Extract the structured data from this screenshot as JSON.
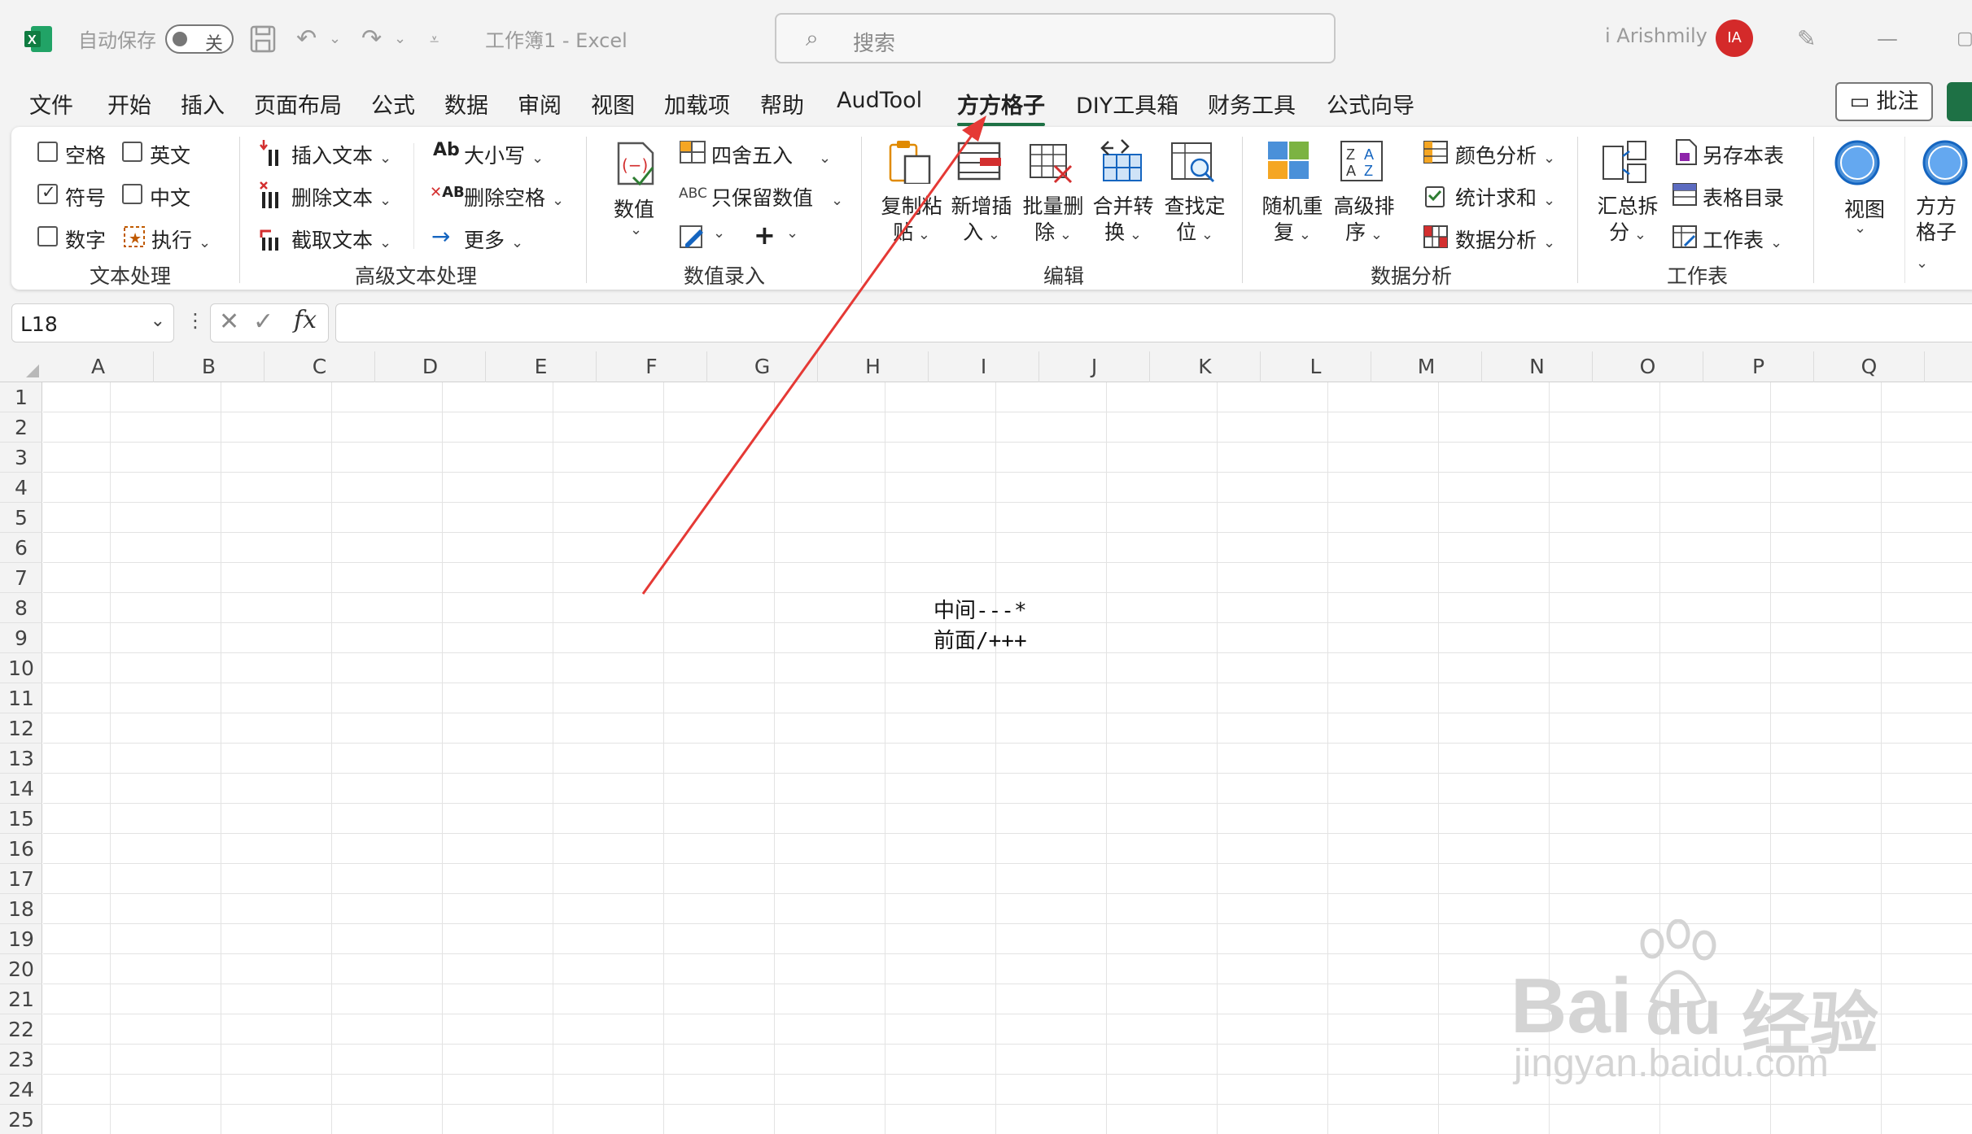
{
  "titlebar": {
    "autosave_label": "自动保存",
    "autosave_state": "关",
    "doc_title": "工作簿1  -  Excel",
    "search_placeholder": "搜索",
    "user_name": "i Arishmily",
    "avatar_initials": "IA"
  },
  "menu": {
    "items": [
      "文件",
      "开始",
      "插入",
      "页面布局",
      "公式",
      "数据",
      "审阅",
      "视图",
      "加载项",
      "帮助",
      "AudTool",
      "方方格子",
      "DIY工具箱",
      "财务工具",
      "公式向导"
    ],
    "active": "方方格子",
    "comment_button": "批注"
  },
  "ribbon": {
    "text_processing": {
      "label": "文本处理",
      "options": [
        "空格",
        "英文",
        "符号",
        "中文",
        "数字"
      ],
      "execute": "执行"
    },
    "advanced_text": {
      "label": "高级文本处理",
      "insert_text": "插入文本",
      "delete_text": "删除文本",
      "extract_text": "截取文本",
      "case": "大小写",
      "delete_spaces": "删除空格",
      "more": "更多"
    },
    "numeric_entry": {
      "label": "数值录入",
      "value_btn": "数值",
      "round": "四舍五入",
      "keep_values": "只保留数值",
      "abc_icon_text": "ABC"
    },
    "edit": {
      "label": "编辑",
      "buttons": [
        "复制粘贴",
        "新增插入",
        "批量删除",
        "合并转换",
        "查找定位"
      ]
    },
    "data_analysis": {
      "label": "数据分析",
      "buttons": [
        "随机重复",
        "高级排序"
      ],
      "color_analysis": "颜色分析",
      "stat_sum": "统计求和",
      "data_analysis_btn": "数据分析"
    },
    "worksheet": {
      "label": "工作表",
      "summary_split": "汇总拆分",
      "save_sheet": "另存本表",
      "sheet_index": "表格目录",
      "worksheet_btn": "工作表"
    },
    "view": {
      "view_btn": "视图",
      "ffgz_btn": "方方格子"
    }
  },
  "formula_bar": {
    "name_box": "L18",
    "fx_label": "fx",
    "formula": ""
  },
  "grid": {
    "columns": [
      "A",
      "B",
      "C",
      "D",
      "E",
      "F",
      "G",
      "H",
      "I",
      "J",
      "K",
      "L",
      "M",
      "N",
      "O",
      "P",
      "Q"
    ],
    "rows": [
      "1",
      "2",
      "3",
      "4",
      "5",
      "6",
      "7",
      "8",
      "9",
      "10",
      "11",
      "12",
      "13",
      "14",
      "15",
      "16",
      "17",
      "18",
      "19",
      "20",
      "21",
      "22",
      "23",
      "24",
      "25"
    ],
    "cells": {
      "I7": "中间---*",
      "I8": "前面/+++"
    }
  },
  "watermark": {
    "brand": "Bai",
    "brand2": "du",
    "cn": "经验",
    "url": "jingyan.baidu.com"
  },
  "colors": {
    "excel_green": "#1e7145",
    "annotation_arrow": "#e53935",
    "avatar": "#d42a2a"
  }
}
